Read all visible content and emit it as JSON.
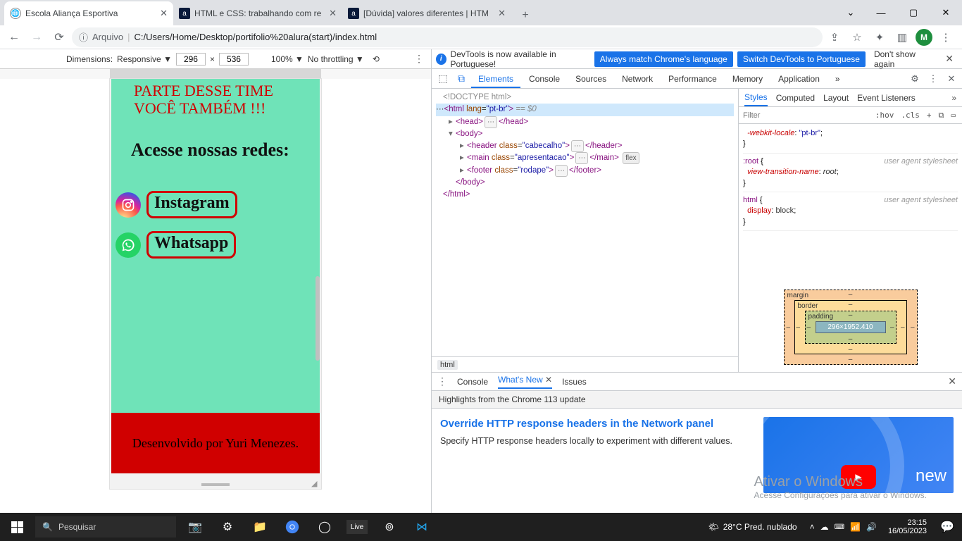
{
  "browser": {
    "tabs": [
      {
        "title": "Escola Aliança Esportiva",
        "active": true
      },
      {
        "title": "HTML e CSS: trabalhando com re",
        "active": false
      },
      {
        "title": "[Dúvida] valores diferentes | HTM",
        "active": false
      }
    ],
    "address_prefix": "Arquivo",
    "address_path": "C:/Users/Home/Desktop/portifolio%20alura(start)/index.html",
    "avatar": "M"
  },
  "device_toolbar": {
    "label": "Dimensions:",
    "mode": "Responsive",
    "width": "296",
    "height": "536",
    "zoom": "100%",
    "throttle": "No throttling"
  },
  "page": {
    "headline": "PARTE DESSE TIME VOCÊ TAMBÉM !!!",
    "subhead": "Acesse nossas redes:",
    "links": {
      "instagram": "Instagram",
      "whatsapp": "Whatsapp"
    },
    "footer": "Desenvolvido por Yuri Menezes."
  },
  "devtools": {
    "info": {
      "msg": "DevTools is now available in Portuguese!",
      "btn1": "Always match Chrome's language",
      "btn2": "Switch DevTools to Portuguese",
      "dismiss": "Don't show again"
    },
    "main_tabs": [
      "Elements",
      "Console",
      "Sources",
      "Network",
      "Performance",
      "Memory",
      "Application"
    ],
    "active_main": "Elements",
    "dom": {
      "doctype": "<!DOCTYPE html>",
      "html_open": "<html lang=\"pt-br\">",
      "html_eq": " == $0",
      "head": "<head>",
      "head_c": "</head>",
      "body": "<body>",
      "header": "<header class=\"cabecalho\">",
      "header_c": "</header>",
      "main": "<main class=\"apresentacao\">",
      "main_c": "</main>",
      "flex": "flex",
      "footer": "<footer class=\"rodape\">",
      "footer_c": "</footer>",
      "body_c": "</body>",
      "html_c": "</html>"
    },
    "crumb": "html",
    "style_tabs": [
      "Styles",
      "Computed",
      "Layout",
      "Event Listeners"
    ],
    "active_style": "Styles",
    "filter": {
      "placeholder": "Filter",
      "hov": ":hov",
      "cls": ".cls"
    },
    "rules": {
      "r0": {
        "prop": "-webkit-locale",
        "val": "\"pt-br\""
      },
      "r1": {
        "sel": ":root",
        "ua": "user agent stylesheet",
        "prop": "view-transition-name",
        "val": "root"
      },
      "r2": {
        "sel": "html",
        "ua": "user agent stylesheet",
        "prop": "display",
        "val": "block"
      }
    },
    "box": {
      "margin": "margin",
      "border": "border",
      "padding": "padding",
      "content": "296×1952.410",
      "dash": "–"
    },
    "drawer": {
      "tabs": [
        "Console",
        "What's New",
        "Issues"
      ],
      "active": "What's New",
      "subtitle": "Highlights from the Chrome 113 update",
      "card_title": "Override HTTP response headers in the Network panel",
      "card_body": "Specify HTTP response headers locally to experiment with different values.",
      "thumb_text": "new"
    }
  },
  "watermark": {
    "l1": "Ativar o Windows",
    "l2": "Acesse Configurações para ativar o Windows."
  },
  "taskbar": {
    "search": "Pesquisar",
    "weather": "28°C  Pred. nublado",
    "time": "23:15",
    "date": "16/05/2023"
  }
}
